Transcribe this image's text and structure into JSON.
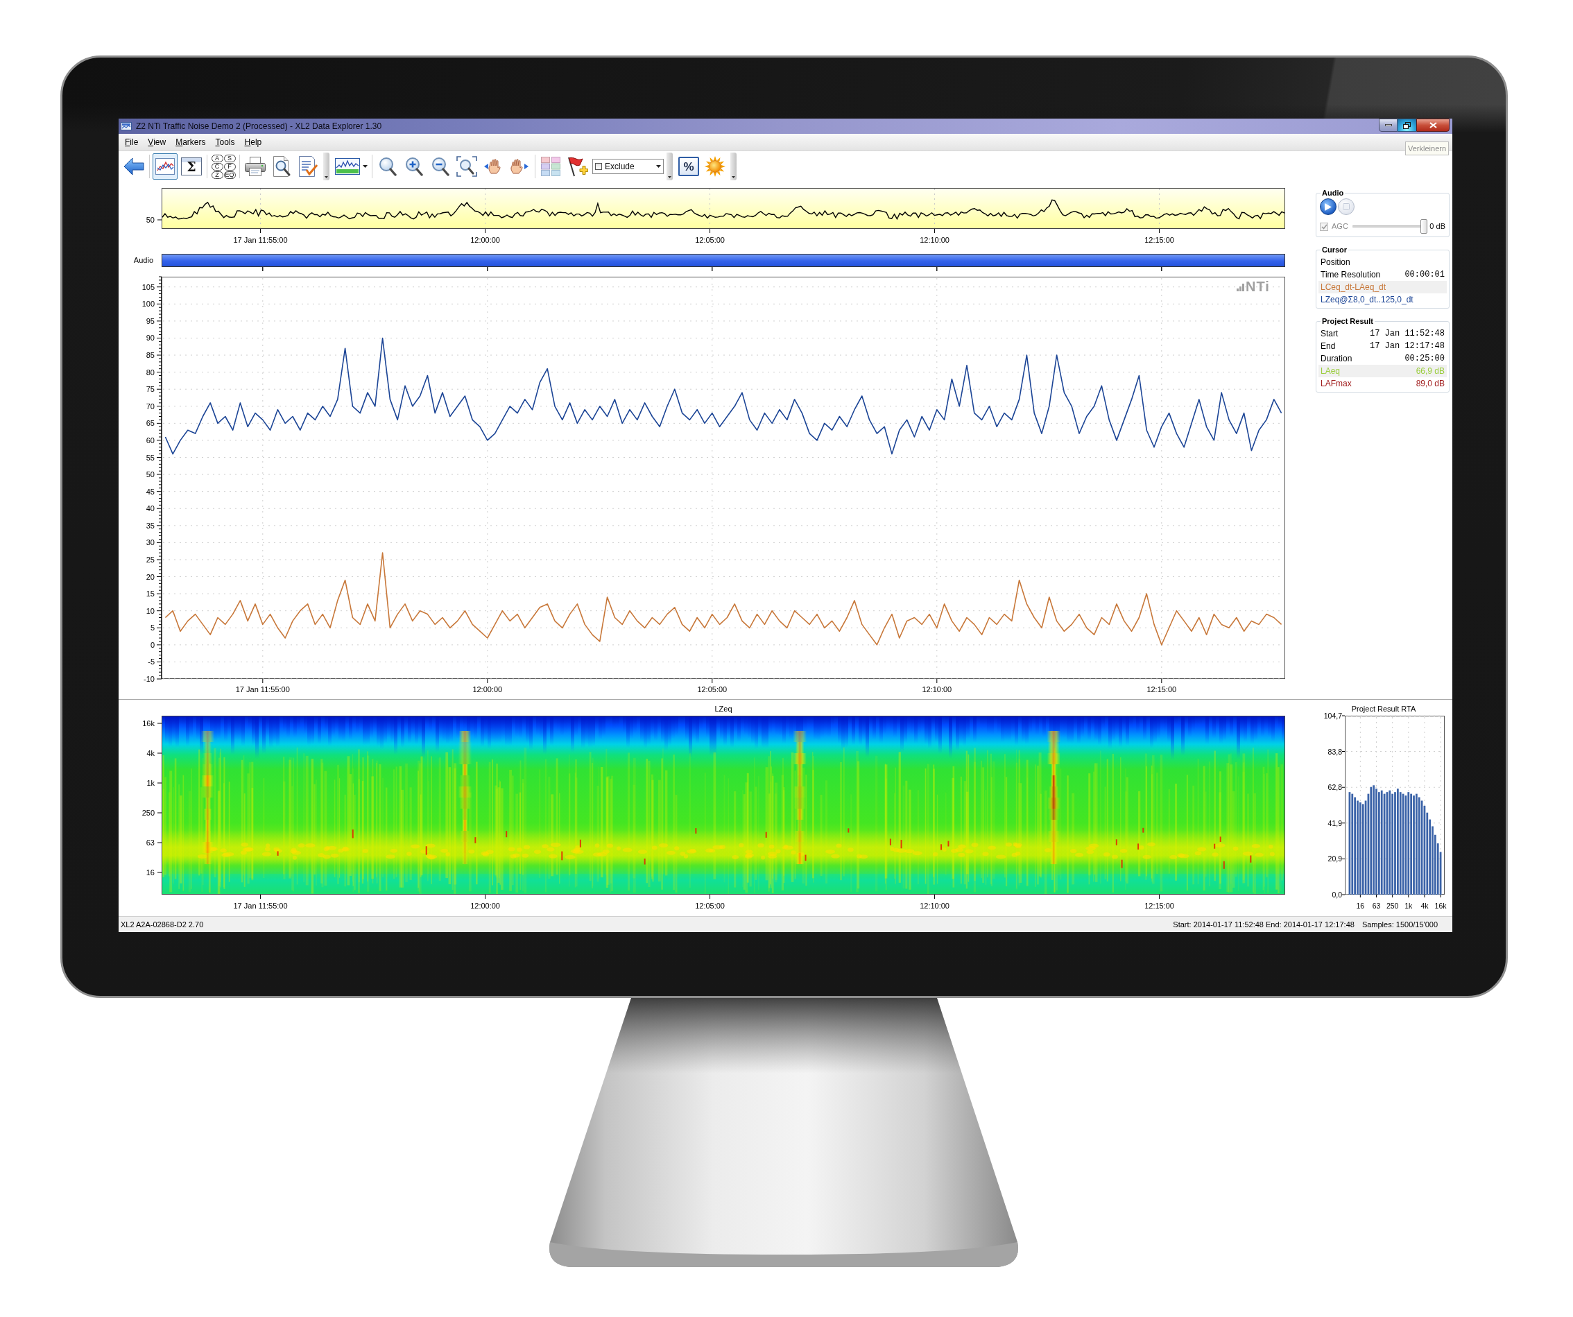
{
  "window": {
    "title": "Z2 NTi Traffic Noise Demo 2 (Processed) - XL2 Data Explorer 1.30",
    "tooltip": "Verkleinern"
  },
  "menu": [
    "File",
    "View",
    "Markers",
    "Tools",
    "Help"
  ],
  "toolbar": {
    "strips": [
      {
        "groups": [
          [
            {
              "kind": "back",
              "selected": false
            }
          ],
          [
            {
              "kind": "chart",
              "selected": true
            },
            {
              "kind": "sigma",
              "glyph": "Σ",
              "selected": false
            }
          ],
          [
            {
              "kind": "weighting",
              "labels": [
                "A",
                "S",
                "C",
                "F",
                "Z",
                "EQ"
              ],
              "selected": false
            }
          ],
          [
            {
              "kind": "print",
              "selected": false
            },
            {
              "kind": "preview",
              "selected": false
            },
            {
              "kind": "report",
              "selected": false
            }
          ]
        ]
      },
      {
        "groups": [
          [
            {
              "kind": "waveform_menu",
              "selected": false
            }
          ],
          [
            {
              "kind": "zoom",
              "selected": false
            },
            {
              "kind": "zoom_in",
              "selected": false
            },
            {
              "kind": "zoom_out",
              "selected": false
            },
            {
              "kind": "zoom_fit",
              "selected": false
            },
            {
              "kind": "pan_left",
              "selected": false
            },
            {
              "kind": "pan_right",
              "selected": false
            }
          ],
          [
            {
              "kind": "tiles",
              "selected": false
            },
            {
              "kind": "flag_add",
              "selected": false
            },
            {
              "kind": "marker_combo",
              "value": "Exclude",
              "checked": false
            }
          ]
        ]
      },
      {
        "groups": [
          [
            {
              "kind": "percent",
              "glyph": "%",
              "selected": false
            },
            {
              "kind": "sun",
              "selected": false
            }
          ]
        ]
      }
    ]
  },
  "overview": {
    "y_label": "50",
    "x_labels": [
      "17 Jan 11:55:00",
      "12:00:00",
      "12:05:00",
      "12:10:00",
      "12:15:00"
    ]
  },
  "audio_track": {
    "label": "Audio"
  },
  "level_chart": {
    "logo": "NTi",
    "chart_data": {
      "type": "line",
      "grid": true,
      "categories": [
        null,
        null,
        null,
        null,
        null,
        null,
        null,
        null,
        null,
        null,
        null,
        null,
        null,
        "17 Jan 11:55:00",
        null,
        null,
        null,
        null,
        null,
        null,
        null,
        null,
        null,
        null,
        null,
        null,
        null,
        null,
        null,
        null,
        null,
        null,
        null,
        null,
        null,
        null,
        null,
        null,
        null,
        null,
        null,
        null,
        null,
        "12:00:00",
        null,
        null,
        null,
        null,
        null,
        null,
        null,
        null,
        null,
        null,
        null,
        null,
        null,
        null,
        null,
        null,
        null,
        null,
        null,
        null,
        null,
        null,
        null,
        null,
        null,
        null,
        null,
        null,
        null,
        "12:05:00",
        null,
        null,
        null,
        null,
        null,
        null,
        null,
        null,
        null,
        null,
        null,
        null,
        null,
        null,
        null,
        null,
        null,
        null,
        null,
        null,
        null,
        null,
        null,
        null,
        null,
        null,
        null,
        null,
        null,
        "12:10:00",
        null,
        null,
        null,
        null,
        null,
        null,
        null,
        null,
        null,
        null,
        null,
        null,
        null,
        null,
        null,
        null,
        null,
        null,
        null,
        null,
        null,
        null,
        null,
        null,
        null,
        null,
        null,
        null,
        null,
        "12:15:00",
        null,
        null,
        null,
        null,
        null,
        null,
        null,
        null,
        null,
        null,
        null,
        null,
        null,
        null,
        null,
        null
      ],
      "series": [
        {
          "color": "#1c4596",
          "values": [
            61,
            56,
            60,
            63,
            62,
            67,
            71,
            65,
            67,
            63,
            71,
            64,
            68,
            66,
            63,
            69,
            65,
            67,
            63,
            68,
            66,
            70,
            67,
            72,
            87,
            70,
            68,
            74,
            70,
            90,
            72,
            66,
            76,
            70,
            73,
            79,
            68,
            74,
            67,
            70,
            73,
            66,
            64,
            60,
            62,
            66,
            70,
            68,
            72,
            69,
            77,
            81,
            70,
            66,
            71,
            65,
            69,
            66,
            70,
            67,
            72,
            65,
            69,
            66,
            71,
            67,
            64,
            70,
            75,
            68,
            66,
            69,
            65,
            68,
            64,
            67,
            70,
            74,
            66,
            63,
            68,
            65,
            69,
            66,
            72,
            68,
            62,
            60,
            65,
            63,
            67,
            64,
            69,
            73,
            66,
            62,
            64,
            56,
            63,
            66,
            61,
            67,
            63,
            69,
            66,
            78,
            70,
            82,
            68,
            66,
            70,
            64,
            68,
            66,
            72,
            85,
            68,
            62,
            70,
            85,
            74,
            70,
            62,
            67,
            70,
            76,
            66,
            60,
            66,
            72,
            79,
            63,
            58,
            64,
            68,
            62,
            58,
            65,
            72,
            64,
            60,
            74,
            66,
            62,
            68,
            57,
            63,
            66,
            72,
            68
          ]
        },
        {
          "color": "#c8783a",
          "values": [
            8,
            10,
            4,
            7,
            9,
            6,
            3,
            8,
            6,
            9,
            13,
            7,
            12,
            6,
            9,
            5,
            2,
            7,
            10,
            12,
            6,
            9,
            5,
            13,
            19,
            8,
            6,
            12,
            7,
            27,
            5,
            9,
            12,
            7,
            10,
            9,
            6,
            8,
            5,
            7,
            10,
            6,
            4,
            2,
            6,
            10,
            7,
            9,
            5,
            8,
            11,
            12,
            7,
            5,
            9,
            12,
            6,
            3,
            1,
            14,
            8,
            6,
            10,
            7,
            5,
            8,
            6,
            9,
            11,
            6,
            4,
            8,
            5,
            9,
            6,
            8,
            12,
            7,
            5,
            9,
            6,
            10,
            7,
            5,
            10,
            8,
            6,
            9,
            5,
            7,
            4,
            8,
            13,
            6,
            3,
            0,
            5,
            9,
            2,
            7,
            8,
            6,
            9,
            5,
            12,
            7,
            4,
            8,
            6,
            3,
            8,
            6,
            9,
            7,
            19,
            12,
            8,
            5,
            14,
            7,
            4,
            6,
            9,
            5,
            3,
            8,
            6,
            12,
            7,
            4,
            8,
            15,
            6,
            0,
            5,
            10,
            7,
            4,
            8,
            3,
            9,
            6,
            5,
            8,
            4,
            7,
            6,
            9,
            8,
            6
          ]
        }
      ],
      "ylim": [
        -10,
        108
      ],
      "yticks": [
        -10,
        -5,
        0,
        5,
        10,
        15,
        20,
        25,
        30,
        35,
        40,
        45,
        50,
        55,
        60,
        65,
        70,
        75,
        80,
        85,
        90,
        95,
        100,
        105
      ]
    }
  },
  "audio_panel": {
    "title": "Audio",
    "transport": [
      {
        "kind": "play",
        "disabled": false
      },
      {
        "kind": "stop",
        "disabled": true
      }
    ],
    "agc": {
      "label": "AGC",
      "checked": true,
      "disabled": true
    },
    "gain": {
      "level": 1,
      "reading": "0 dB"
    }
  },
  "cursor_panel": {
    "title": "Cursor",
    "rows": [
      {
        "kind": "field",
        "label": "Position",
        "selected": false
      },
      {
        "kind": "field",
        "label": "Time Resolution",
        "value": "00:00:01",
        "selected": false
      },
      {
        "kind": "channel",
        "label": "LCeq_dt-LAeq_dt",
        "color": "#c8783a",
        "selected": true
      },
      {
        "kind": "channel",
        "label": "LZeq@Σ8,0_dt..125,0_dt",
        "color": "#1c4596",
        "selected": false
      }
    ]
  },
  "project_panel": {
    "title": "Project Result",
    "rows": [
      {
        "kind": "field",
        "label": "Start",
        "value": "17 Jan 11:52:48",
        "selected": false
      },
      {
        "kind": "field",
        "label": "End",
        "value": "17 Jan 12:17:48",
        "selected": false
      },
      {
        "kind": "field",
        "label": "Duration",
        "value": "00:25:00",
        "selected": false
      },
      {
        "kind": "channel",
        "label": "LAeq",
        "value": "66,9 dB",
        "color": "#9acd3c",
        "selected": true
      },
      {
        "kind": "channel",
        "label": "LAFmax",
        "value": "89,0 dB",
        "color": "#a01c1c",
        "selected": false
      }
    ]
  },
  "spectrogram": {
    "title": "LZeq",
    "y_labels": [
      "16k",
      "4k",
      "1k",
      "250",
      "63",
      "16"
    ],
    "x_labels": [
      "17 Jan 11:55:00",
      "12:00:00",
      "12:05:00",
      "12:10:00",
      "12:15:00"
    ]
  },
  "rta": {
    "chart_data": {
      "type": "bar",
      "title": "Project Result RTA",
      "grid": true,
      "categories": [
        null,
        null,
        null,
        null,
        "16",
        null,
        null,
        null,
        null,
        null,
        "63",
        null,
        null,
        null,
        null,
        null,
        "250",
        null,
        null,
        null,
        null,
        null,
        "1k",
        null,
        null,
        null,
        null,
        null,
        "4k",
        null,
        null,
        null,
        null,
        null,
        "16k"
      ],
      "values": [
        60,
        59,
        57,
        55,
        54,
        53,
        55,
        59,
        63,
        64,
        62,
        60,
        61,
        59,
        60,
        61,
        59,
        60,
        62,
        60,
        59,
        58,
        60,
        59,
        58,
        59,
        57,
        55,
        52,
        48,
        44,
        40,
        35,
        30,
        25
      ],
      "ylim": [
        0,
        104.7
      ],
      "yticks": [
        {
          "value": 0,
          "label": "0,0"
        },
        {
          "value": 20.9,
          "label": "20,9"
        },
        {
          "value": 41.9,
          "label": "41,9"
        },
        {
          "value": 62.8,
          "label": "62,8"
        },
        {
          "value": 83.8,
          "label": "83,8"
        },
        {
          "value": 104.7,
          "label": "104,7"
        }
      ]
    }
  },
  "status_bar": {
    "left": "XL2 A2A-02868-D2 2.70",
    "range": "Start: 2014-01-17 11:52:48 End: 2014-01-17 12:17:48",
    "samples": "Samples: 1500/15'000"
  }
}
